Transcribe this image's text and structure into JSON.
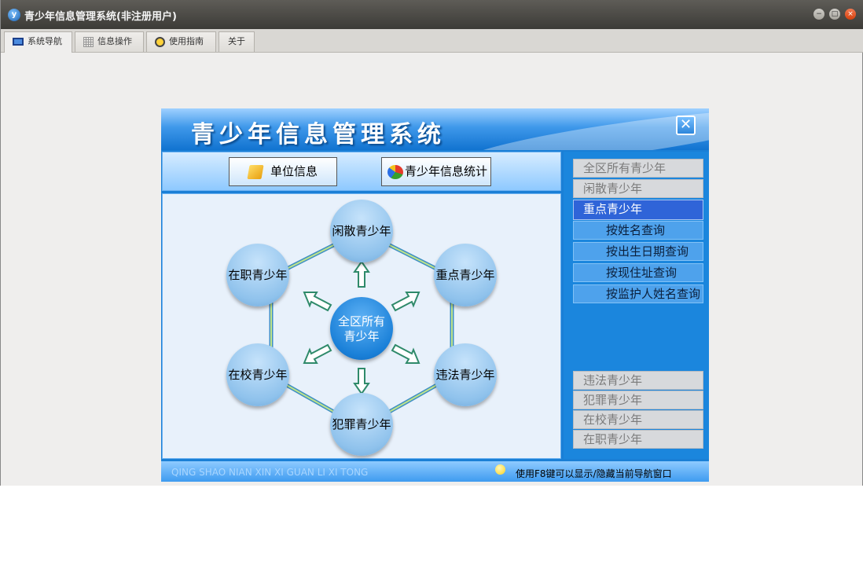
{
  "window": {
    "title": "青少年信息管理系统(非注册用户)",
    "app_icon": "app-logo-icon",
    "controls": [
      "minimize-icon",
      "maximize-icon",
      "close-icon"
    ]
  },
  "tabs": [
    {
      "label": "系统导航",
      "icon": "monitor-icon",
      "active": true
    },
    {
      "label": "信息操作",
      "icon": "grid-icon",
      "active": false
    },
    {
      "label": "使用指南",
      "icon": "bulb-icon",
      "active": false
    },
    {
      "label": "关于",
      "icon": "",
      "active": false
    }
  ],
  "panel": {
    "title": "青少年信息管理系统",
    "close_glyph": "✕",
    "buttons": {
      "unit_info": "单位信息",
      "stats": "青少年信息统计"
    },
    "diagram": {
      "center": [
        "全区所有",
        "青少年"
      ],
      "nodes": {
        "top": "闲散青少年",
        "upper_right": "重点青少年",
        "lower_right": "违法青少年",
        "bottom": "犯罪青少年",
        "lower_left": "在校青少年",
        "upper_left": "在职青少年"
      }
    },
    "sidebar": {
      "top_items": [
        "全区所有青少年",
        "闲散青少年"
      ],
      "selected": "重点青少年",
      "sub_items": [
        "按姓名查询",
        "按出生日期查询",
        "按现住址查询",
        "按监护人姓名查询"
      ],
      "bottom_items": [
        "违法青少年",
        "犯罪青少年",
        "在校青少年",
        "在职青少年"
      ]
    },
    "status": {
      "pinyin": "QING SHAO NIAN XIN XI GUAN LI XI TONG",
      "hint": "使用F8键可以显示/隐藏当前导航窗口",
      "hint_icon": "lightbulb-icon"
    }
  },
  "colors": {
    "accent": "#1a7fd6",
    "selected": "#2f64d8",
    "connector": "#7fc3e0"
  }
}
